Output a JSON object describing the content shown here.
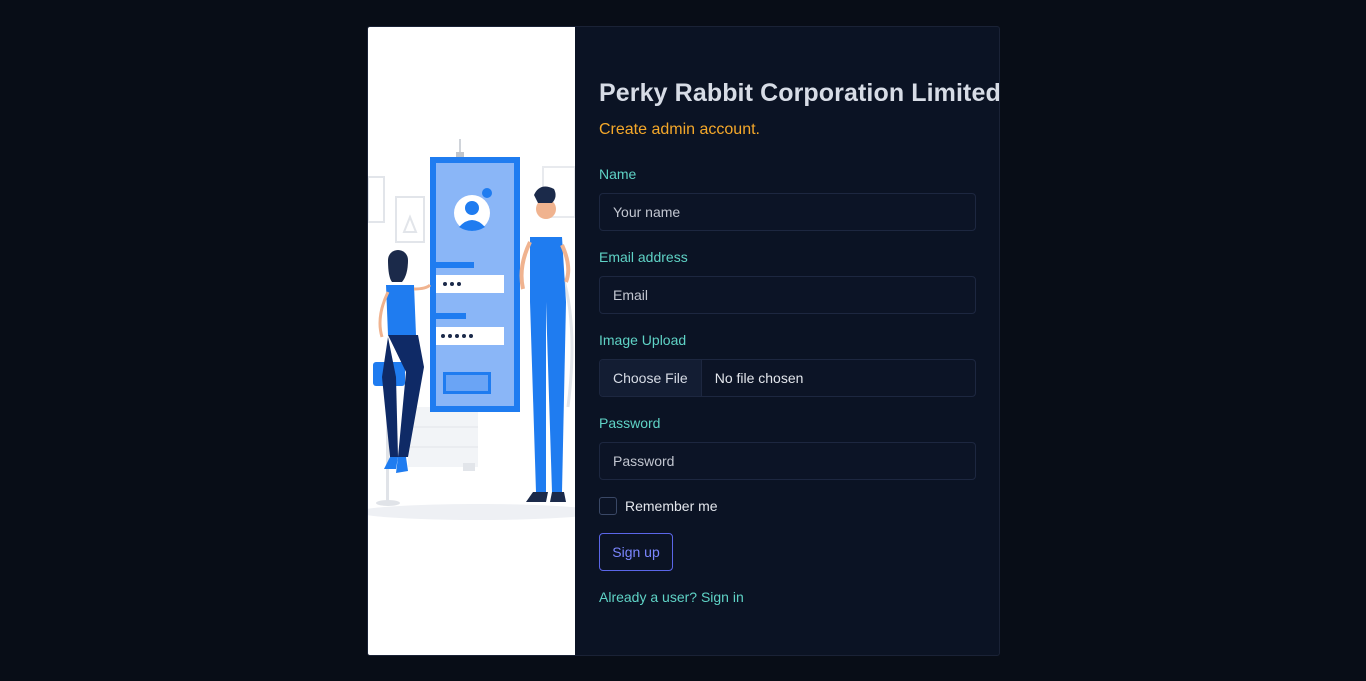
{
  "header": {
    "title": "Perky Rabbit Corporation Limited",
    "subtitle": "Create admin account."
  },
  "form": {
    "name": {
      "label": "Name",
      "placeholder": "Your name"
    },
    "email": {
      "label": "Email address",
      "placeholder": "Email"
    },
    "image": {
      "label": "Image Upload",
      "button": "Choose File",
      "status": "No file chosen"
    },
    "password": {
      "label": "Password",
      "placeholder": "Password"
    },
    "remember": {
      "label": "Remember me",
      "checked": false
    },
    "submit_label": "Sign up",
    "signin_link": "Already a user? Sign in"
  },
  "colors": {
    "page_bg": "#080d17",
    "card_bg": "#0b1324",
    "title": "#d7dce6",
    "subtitle": "#f5a82a",
    "label": "#5fd3c6",
    "button_border": "#5b66e8",
    "button_text": "#7b86ff",
    "illustration_blue": "#1f7cf0"
  },
  "illustration": {
    "icon": "login-illustration"
  }
}
